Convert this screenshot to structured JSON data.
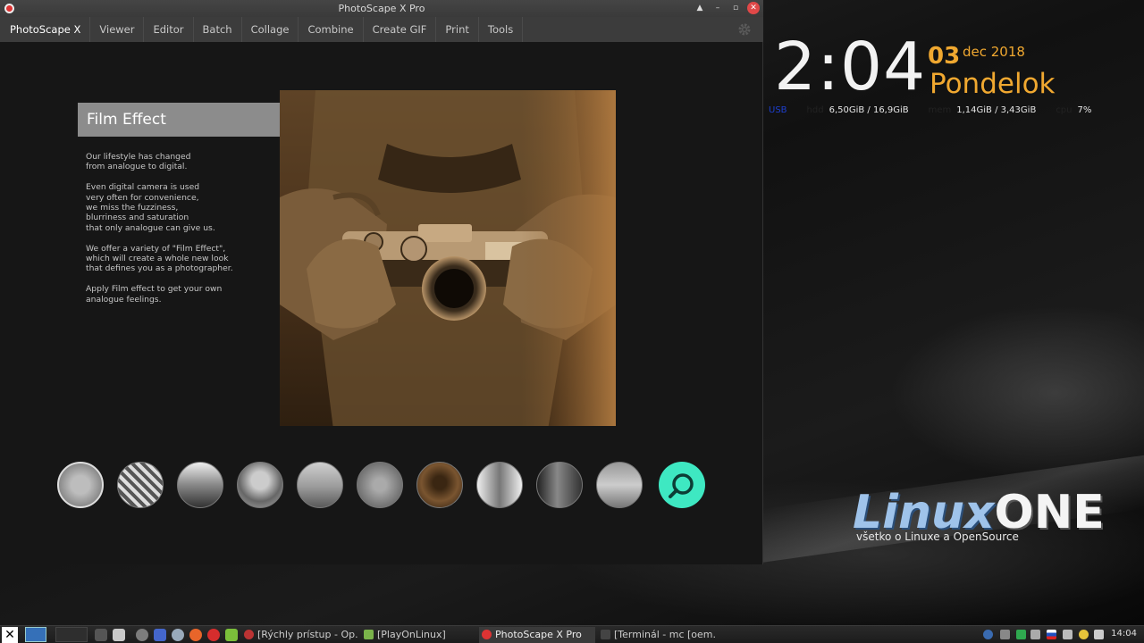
{
  "window": {
    "title": "PhotoScape X Pro",
    "controls": [
      "▲",
      "–",
      "▫",
      "✕"
    ]
  },
  "menu": {
    "items": [
      "PhotoScape X",
      "Viewer",
      "Editor",
      "Batch",
      "Collage",
      "Combine",
      "Create GIF",
      "Print",
      "Tools"
    ],
    "settings_icon": "gear-icon"
  },
  "content": {
    "heading": "Film Effect",
    "paragraphs": [
      [
        "Our lifestyle has changed",
        "from analogue to digital."
      ],
      [
        "Even digital camera is used",
        "very often for convenience,",
        "we miss the fuzziness,",
        "blurriness and saturation",
        "that only analogue can give us."
      ],
      [
        "We offer a variety of \"Film Effect\",",
        "which will create a whole new look",
        "that defines you as a photographer."
      ],
      [
        "Apply Film effect to get your own",
        "analogue feelings."
      ]
    ],
    "thumbnail_count": 10,
    "thumb_more_icon": "search-icon"
  },
  "desktop": {
    "clock": {
      "time": "2:04",
      "day": "03",
      "month_year": "dec 2018",
      "weekday": "Pondelok"
    },
    "sysinfo": {
      "usb_label": "USB",
      "hdd_label": "hdd",
      "hdd_value": "6,50GiB / 16,9GiB",
      "mem_label": "mem",
      "mem_value": "1,14GiB / 3,43GiB",
      "cpu_label": "cpu",
      "cpu_value": "7%"
    },
    "logo": {
      "text": "LinuxONE",
      "subtitle": "všetko o Linuxe a OpenSource"
    }
  },
  "taskbar": {
    "tasks": [
      "[Rýchly prístup - Op...",
      "[PlayOnLinux]",
      "PhotoScape X Pro",
      "[Terminál - mc [oem..."
    ],
    "time": "14:04"
  },
  "colors": {
    "accent_orange": "#f0a830",
    "teal": "#3ee8c2",
    "header_gray": "#8c8c8c"
  }
}
